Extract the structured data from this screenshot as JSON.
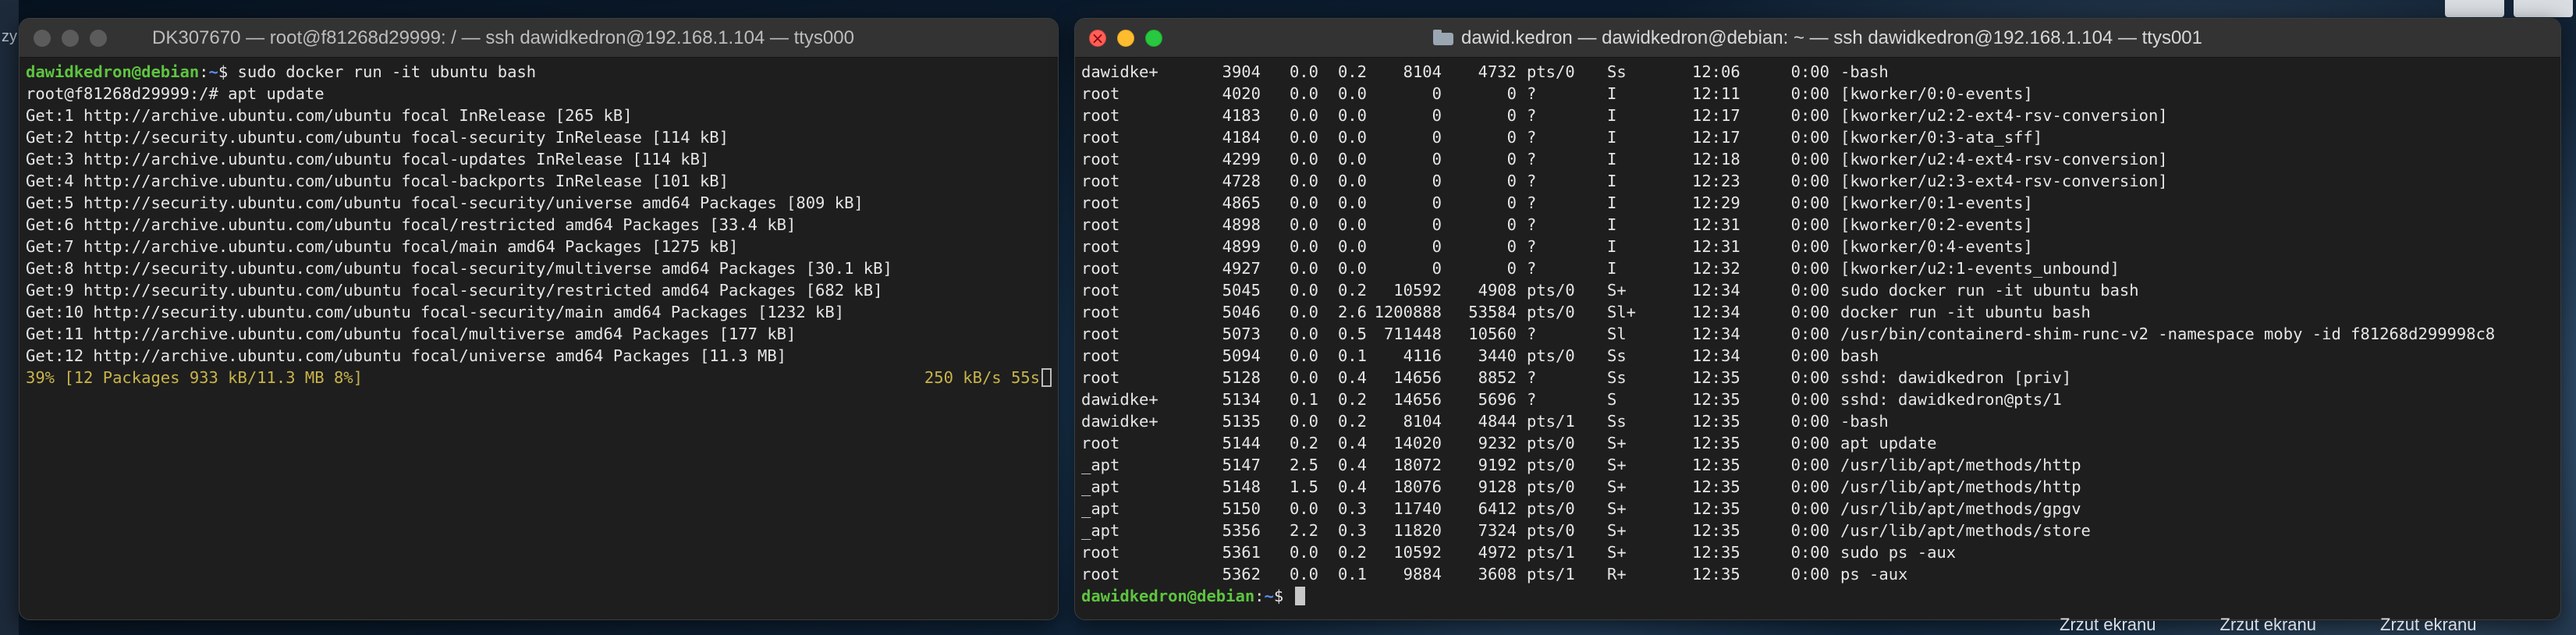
{
  "desktop": {
    "edge_label": "zy",
    "screenshot_labels": [
      "Zrzut ekranu",
      "Zrzut ekranu",
      "Zrzut ekranu"
    ]
  },
  "left_window": {
    "title": "DK307670 — root@f81268d29999: / — ssh dawidkedron@192.168.1.104 — ttys000",
    "prompt_user": "dawidkedron@debian",
    "prompt_path": "~",
    "first_command": "sudo docker run -it ubuntu bash",
    "root_prompt": "root@f81268d29999:/# apt update",
    "lines": [
      "Get:1 http://archive.ubuntu.com/ubuntu focal InRelease [265 kB]",
      "Get:2 http://security.ubuntu.com/ubuntu focal-security InRelease [114 kB]",
      "Get:3 http://archive.ubuntu.com/ubuntu focal-updates InRelease [114 kB]",
      "Get:4 http://archive.ubuntu.com/ubuntu focal-backports InRelease [101 kB]",
      "Get:5 http://security.ubuntu.com/ubuntu focal-security/universe amd64 Packages [809 kB]",
      "Get:6 http://archive.ubuntu.com/ubuntu focal/restricted amd64 Packages [33.4 kB]",
      "Get:7 http://archive.ubuntu.com/ubuntu focal/main amd64 Packages [1275 kB]",
      "Get:8 http://security.ubuntu.com/ubuntu focal-security/multiverse amd64 Packages [30.1 kB]",
      "Get:9 http://security.ubuntu.com/ubuntu focal-security/restricted amd64 Packages [682 kB]",
      "Get:10 http://security.ubuntu.com/ubuntu focal-security/main amd64 Packages [1232 kB]",
      "Get:11 http://archive.ubuntu.com/ubuntu focal/multiverse amd64 Packages [177 kB]",
      "Get:12 http://archive.ubuntu.com/ubuntu focal/universe amd64 Packages [11.3 MB]"
    ],
    "progress_left": "39% [12 Packages 933 kB/11.3 MB 8%]",
    "progress_right": "250 kB/s 55s"
  },
  "right_window": {
    "title": "dawid.kedron — dawidkedron@debian: ~ — ssh dawidkedron@192.168.1.104 — ttys001",
    "processes": [
      {
        "user": "dawidke+",
        "pid": "3904",
        "cpu": "0.0",
        "mem": "0.2",
        "vsz": "8104",
        "rss": "4732",
        "tty": "pts/0",
        "stat": "Ss",
        "start": "12:06",
        "time": "0:00",
        "cmd": "-bash"
      },
      {
        "user": "root",
        "pid": "4020",
        "cpu": "0.0",
        "mem": "0.0",
        "vsz": "0",
        "rss": "0",
        "tty": "?",
        "stat": "I",
        "start": "12:11",
        "time": "0:00",
        "cmd": "[kworker/0:0-events]"
      },
      {
        "user": "root",
        "pid": "4183",
        "cpu": "0.0",
        "mem": "0.0",
        "vsz": "0",
        "rss": "0",
        "tty": "?",
        "stat": "I",
        "start": "12:17",
        "time": "0:00",
        "cmd": "[kworker/u2:2-ext4-rsv-conversion]"
      },
      {
        "user": "root",
        "pid": "4184",
        "cpu": "0.0",
        "mem": "0.0",
        "vsz": "0",
        "rss": "0",
        "tty": "?",
        "stat": "I",
        "start": "12:17",
        "time": "0:00",
        "cmd": "[kworker/0:3-ata_sff]"
      },
      {
        "user": "root",
        "pid": "4299",
        "cpu": "0.0",
        "mem": "0.0",
        "vsz": "0",
        "rss": "0",
        "tty": "?",
        "stat": "I",
        "start": "12:18",
        "time": "0:00",
        "cmd": "[kworker/u2:4-ext4-rsv-conversion]"
      },
      {
        "user": "root",
        "pid": "4728",
        "cpu": "0.0",
        "mem": "0.0",
        "vsz": "0",
        "rss": "0",
        "tty": "?",
        "stat": "I",
        "start": "12:23",
        "time": "0:00",
        "cmd": "[kworker/u2:3-ext4-rsv-conversion]"
      },
      {
        "user": "root",
        "pid": "4865",
        "cpu": "0.0",
        "mem": "0.0",
        "vsz": "0",
        "rss": "0",
        "tty": "?",
        "stat": "I",
        "start": "12:29",
        "time": "0:00",
        "cmd": "[kworker/0:1-events]"
      },
      {
        "user": "root",
        "pid": "4898",
        "cpu": "0.0",
        "mem": "0.0",
        "vsz": "0",
        "rss": "0",
        "tty": "?",
        "stat": "I",
        "start": "12:31",
        "time": "0:00",
        "cmd": "[kworker/0:2-events]"
      },
      {
        "user": "root",
        "pid": "4899",
        "cpu": "0.0",
        "mem": "0.0",
        "vsz": "0",
        "rss": "0",
        "tty": "?",
        "stat": "I",
        "start": "12:31",
        "time": "0:00",
        "cmd": "[kworker/0:4-events]"
      },
      {
        "user": "root",
        "pid": "4927",
        "cpu": "0.0",
        "mem": "0.0",
        "vsz": "0",
        "rss": "0",
        "tty": "?",
        "stat": "I",
        "start": "12:32",
        "time": "0:00",
        "cmd": "[kworker/u2:1-events_unbound]"
      },
      {
        "user": "root",
        "pid": "5045",
        "cpu": "0.0",
        "mem": "0.2",
        "vsz": "10592",
        "rss": "4908",
        "tty": "pts/0",
        "stat": "S+",
        "start": "12:34",
        "time": "0:00",
        "cmd": "sudo docker run -it ubuntu bash"
      },
      {
        "user": "root",
        "pid": "5046",
        "cpu": "0.0",
        "mem": "2.6",
        "vsz": "1200888",
        "rss": "53584",
        "tty": "pts/0",
        "stat": "Sl+",
        "start": "12:34",
        "time": "0:00",
        "cmd": "docker run -it ubuntu bash"
      },
      {
        "user": "root",
        "pid": "5073",
        "cpu": "0.0",
        "mem": "0.5",
        "vsz": "711448",
        "rss": "10560",
        "tty": "?",
        "stat": "Sl",
        "start": "12:34",
        "time": "0:00",
        "cmd": "/usr/bin/containerd-shim-runc-v2 -namespace moby -id f81268d299998c8"
      },
      {
        "user": "root",
        "pid": "5094",
        "cpu": "0.0",
        "mem": "0.1",
        "vsz": "4116",
        "rss": "3440",
        "tty": "pts/0",
        "stat": "Ss",
        "start": "12:34",
        "time": "0:00",
        "cmd": "bash"
      },
      {
        "user": "root",
        "pid": "5128",
        "cpu": "0.0",
        "mem": "0.4",
        "vsz": "14656",
        "rss": "8852",
        "tty": "?",
        "stat": "Ss",
        "start": "12:35",
        "time": "0:00",
        "cmd": "sshd: dawidkedron [priv]"
      },
      {
        "user": "dawidke+",
        "pid": "5134",
        "cpu": "0.1",
        "mem": "0.2",
        "vsz": "14656",
        "rss": "5696",
        "tty": "?",
        "stat": "S",
        "start": "12:35",
        "time": "0:00",
        "cmd": "sshd: dawidkedron@pts/1"
      },
      {
        "user": "dawidke+",
        "pid": "5135",
        "cpu": "0.0",
        "mem": "0.2",
        "vsz": "8104",
        "rss": "4844",
        "tty": "pts/1",
        "stat": "Ss",
        "start": "12:35",
        "time": "0:00",
        "cmd": "-bash"
      },
      {
        "user": "root",
        "pid": "5144",
        "cpu": "0.2",
        "mem": "0.4",
        "vsz": "14020",
        "rss": "9232",
        "tty": "pts/0",
        "stat": "S+",
        "start": "12:35",
        "time": "0:00",
        "cmd": "apt update"
      },
      {
        "user": "_apt",
        "pid": "5147",
        "cpu": "2.5",
        "mem": "0.4",
        "vsz": "18072",
        "rss": "9192",
        "tty": "pts/0",
        "stat": "S+",
        "start": "12:35",
        "time": "0:00",
        "cmd": "/usr/lib/apt/methods/http"
      },
      {
        "user": "_apt",
        "pid": "5148",
        "cpu": "1.5",
        "mem": "0.4",
        "vsz": "18076",
        "rss": "9128",
        "tty": "pts/0",
        "stat": "S+",
        "start": "12:35",
        "time": "0:00",
        "cmd": "/usr/lib/apt/methods/http"
      },
      {
        "user": "_apt",
        "pid": "5150",
        "cpu": "0.0",
        "mem": "0.3",
        "vsz": "11740",
        "rss": "6412",
        "tty": "pts/0",
        "stat": "S+",
        "start": "12:35",
        "time": "0:00",
        "cmd": "/usr/lib/apt/methods/gpgv"
      },
      {
        "user": "_apt",
        "pid": "5356",
        "cpu": "2.2",
        "mem": "0.3",
        "vsz": "11820",
        "rss": "7324",
        "tty": "pts/0",
        "stat": "S+",
        "start": "12:35",
        "time": "0:00",
        "cmd": "/usr/lib/apt/methods/store"
      },
      {
        "user": "root",
        "pid": "5361",
        "cpu": "0.0",
        "mem": "0.2",
        "vsz": "10592",
        "rss": "4972",
        "tty": "pts/1",
        "stat": "S+",
        "start": "12:35",
        "time": "0:00",
        "cmd": "sudo ps -aux"
      },
      {
        "user": "root",
        "pid": "5362",
        "cpu": "0.0",
        "mem": "0.1",
        "vsz": "9884",
        "rss": "3608",
        "tty": "pts/1",
        "stat": "R+",
        "start": "12:35",
        "time": "0:00",
        "cmd": "ps -aux"
      }
    ],
    "prompt_user": "dawidkedron@debian",
    "prompt_path": "~"
  },
  "colors": {
    "prompt_user": "#5ec440",
    "prompt_path": "#5b8def",
    "progress_text": "#c9b44a",
    "close_light": "#ff5f57",
    "minimize_light": "#febc2e",
    "maximize_light": "#28c840"
  },
  "icons": [
    "close-icon",
    "minimize-icon",
    "maximize-icon",
    "folder-icon",
    "cursor-icon"
  ]
}
